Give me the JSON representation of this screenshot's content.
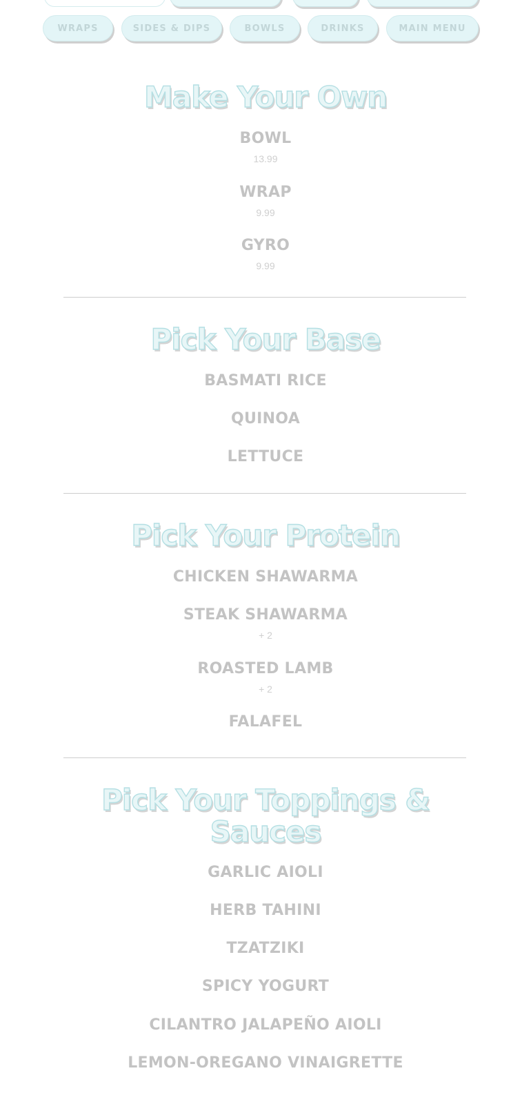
{
  "nav": {
    "items": [
      {
        "label": "WRAPS"
      },
      {
        "label": "SIDES & DIPS"
      },
      {
        "label": "BOWLS"
      },
      {
        "label": "DRINKS"
      },
      {
        "label": "MAIN MENU"
      }
    ]
  },
  "sections": [
    {
      "title": "Make Your Own",
      "items": [
        {
          "name": "BOWL",
          "price": "13.99"
        },
        {
          "name": "WRAP",
          "price": "9.99"
        },
        {
          "name": "GYRO",
          "price": "9.99"
        }
      ]
    },
    {
      "title": "Pick Your Base",
      "items": [
        {
          "name": "BASMATI RICE"
        },
        {
          "name": "QUINOA"
        },
        {
          "name": "LETTUCE"
        }
      ]
    },
    {
      "title": "Pick Your Protein",
      "items": [
        {
          "name": "CHICKEN SHAWARMA"
        },
        {
          "name": "STEAK SHAWARMA",
          "price": "+ 2"
        },
        {
          "name": "ROASTED LAMB",
          "price": "+ 2"
        },
        {
          "name": "FALAFEL"
        }
      ]
    },
    {
      "title": "Pick Your Toppings & Sauces",
      "title_line1": "Pick Your Toppings &",
      "title_line2": "Sauces",
      "items": [
        {
          "name": "GARLIC AIOLI"
        },
        {
          "name": "HERB TAHINI"
        },
        {
          "name": "TZATZIKI"
        },
        {
          "name": "SPICY YOGURT"
        },
        {
          "name": "CILANTRO JALAPEÑO AIOLI"
        },
        {
          "name": "LEMON-OREGANO VINAIGRETTE"
        }
      ]
    }
  ],
  "colors": {
    "pill_bg": "#e3f5f7",
    "title_stroke": "#b4dfe3",
    "item_text": "#c3c3c3"
  }
}
